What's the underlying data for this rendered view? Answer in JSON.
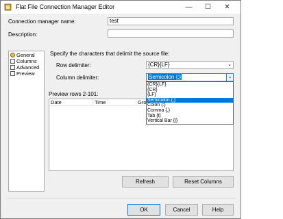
{
  "window": {
    "title": "Flat File Connection Manager Editor",
    "minimize_glyph": "—",
    "maximize_glyph": "☐",
    "close_glyph": "✕"
  },
  "form": {
    "name_label": "Connection manager name:",
    "name_value": "test",
    "description_label": "Description:",
    "description_value": ""
  },
  "nav": {
    "items": [
      {
        "label": "General",
        "icon": "general-page-icon"
      },
      {
        "label": "Columns",
        "icon": "columns-page-icon"
      },
      {
        "label": "Advanced",
        "icon": "advanced-page-icon"
      },
      {
        "label": "Preview",
        "icon": "preview-page-icon"
      }
    ]
  },
  "delimiters": {
    "heading": "Specify the characters that delimit the source file:",
    "row_label": "Row delimiter:",
    "row_value": "{CR}{LF}",
    "column_label": "Column delimiter:",
    "column_value": "Semicolon {;}",
    "options": [
      "{CR}{LF}",
      "{CR}",
      "{LF}",
      "Semicolon {;}",
      "Colon {:}",
      "Comma {,}",
      "Tab {t}",
      "Vertical Bar {|}"
    ],
    "selected_index": 3
  },
  "preview": {
    "label": "Preview rows 2-101:",
    "columns": [
      "Date",
      "Time",
      "Grou"
    ]
  },
  "buttons": {
    "refresh": "Refresh",
    "reset_columns": "Reset Columns",
    "ok": "OK",
    "cancel": "Cancel",
    "help": "Help"
  },
  "colors": {
    "accent": "#0078d7",
    "window_bg": "#f0f0f0"
  }
}
